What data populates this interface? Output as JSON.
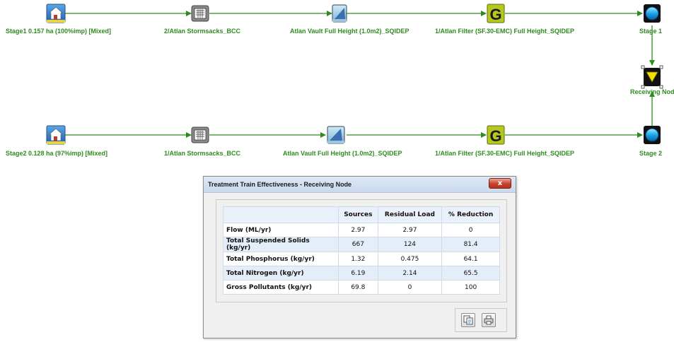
{
  "diagram": {
    "row1": {
      "source_label": "Stage1 0.157 ha (100%imp) [Mixed]",
      "stormsacks_label": "2/Atlan Stormsacks_BCC",
      "vault_label": "Atlan Vault Full Height (1.0m2)_SQIDEP",
      "filter_label": "1/Atlan Filter (SF.30-EMC) Full Height_SQIDEP",
      "stage_label": "Stage 1"
    },
    "receiving_label": "Receiving Node",
    "row2": {
      "source_label": "Stage2 0.128 ha (97%imp) [Mixed]",
      "stormsacks_label": "1/Atlan Stormsacks_BCC",
      "vault_label": "Atlan Vault Full Height (1.0m2)_SQIDEP",
      "filter_label": "1/Atlan Filter (SF.30-EMC) Full Height_SQIDEP",
      "stage_label": "Stage 2"
    },
    "filter_glyph": "G",
    "colors": {
      "link": "#2e8b1f",
      "label": "#2e8b1f"
    }
  },
  "dialog": {
    "title": "Treatment Train Effectiveness - Receiving Node",
    "close_glyph": "x",
    "columns": [
      "",
      "Sources",
      "Residual Load",
      "% Reduction"
    ],
    "rows": [
      {
        "name": "Flow (ML/yr)",
        "sources": "2.97",
        "residual": "2.97",
        "reduction": "0"
      },
      {
        "name": "Total Suspended Solids (kg/yr)",
        "sources": "667",
        "residual": "124",
        "reduction": "81.4"
      },
      {
        "name": "Total Phosphorus (kg/yr)",
        "sources": "1.32",
        "residual": "0.475",
        "reduction": "64.1"
      },
      {
        "name": "Total Nitrogen (kg/yr)",
        "sources": "6.19",
        "residual": "2.14",
        "reduction": "65.5"
      },
      {
        "name": "Gross Pollutants (kg/yr)",
        "sources": "69.8",
        "residual": "0",
        "reduction": "100"
      }
    ],
    "buttons": {
      "copy_icon": "copy-icon",
      "print_icon": "print-icon"
    }
  }
}
